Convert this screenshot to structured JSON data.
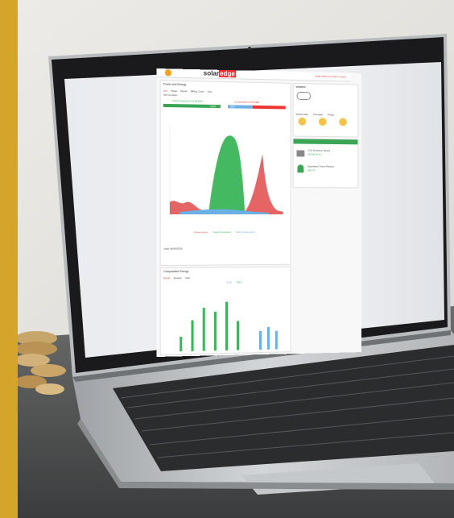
{
  "photo": {
    "colors": {
      "accent_bar": "#d4a52a",
      "wall": "#e9e7e3",
      "desk": "#4a4c4c",
      "laptop": "#c9cbcd",
      "bezel": "#1d1d1f"
    }
  },
  "app": {
    "brand_left": "solar",
    "brand_right": "edge",
    "header_links": "Share  Welcome Adam  Logout",
    "power_section_title": "Power and Energy",
    "tabs": [
      "Day",
      "Week",
      "Month",
      "Billing Cycle",
      "Year"
    ],
    "sub_tab": "Self Consum.",
    "solar_production_label": "Solar Production",
    "solar_production_value": "32.00 kWh",
    "consumption_label": "Consumption",
    "consumption_value": "19.8 kWh",
    "bar_green_pct": "100%",
    "bar_blue_pct": "43%",
    "legend": [
      "Consumption",
      "Solar Production",
      "Self Consumption"
    ],
    "date_label": "Date 06/04/2018",
    "comparative_title": "Comparative Energy",
    "comparative_tabs": [
      "Month",
      "Quarter",
      "Year"
    ],
    "comparative_legend": [
      "2018",
      "2019"
    ],
    "weather_title": "Weather",
    "weather_days": [
      "Wednesday",
      "Thursday",
      "Friday"
    ],
    "env_title": "Environmental Benefits",
    "env_item1": "CO2 Emission Saved",
    "env_value1": "30,699.30 lb",
    "env_item2": "Equivalent Trees Planted",
    "env_value2": "556.76"
  }
}
